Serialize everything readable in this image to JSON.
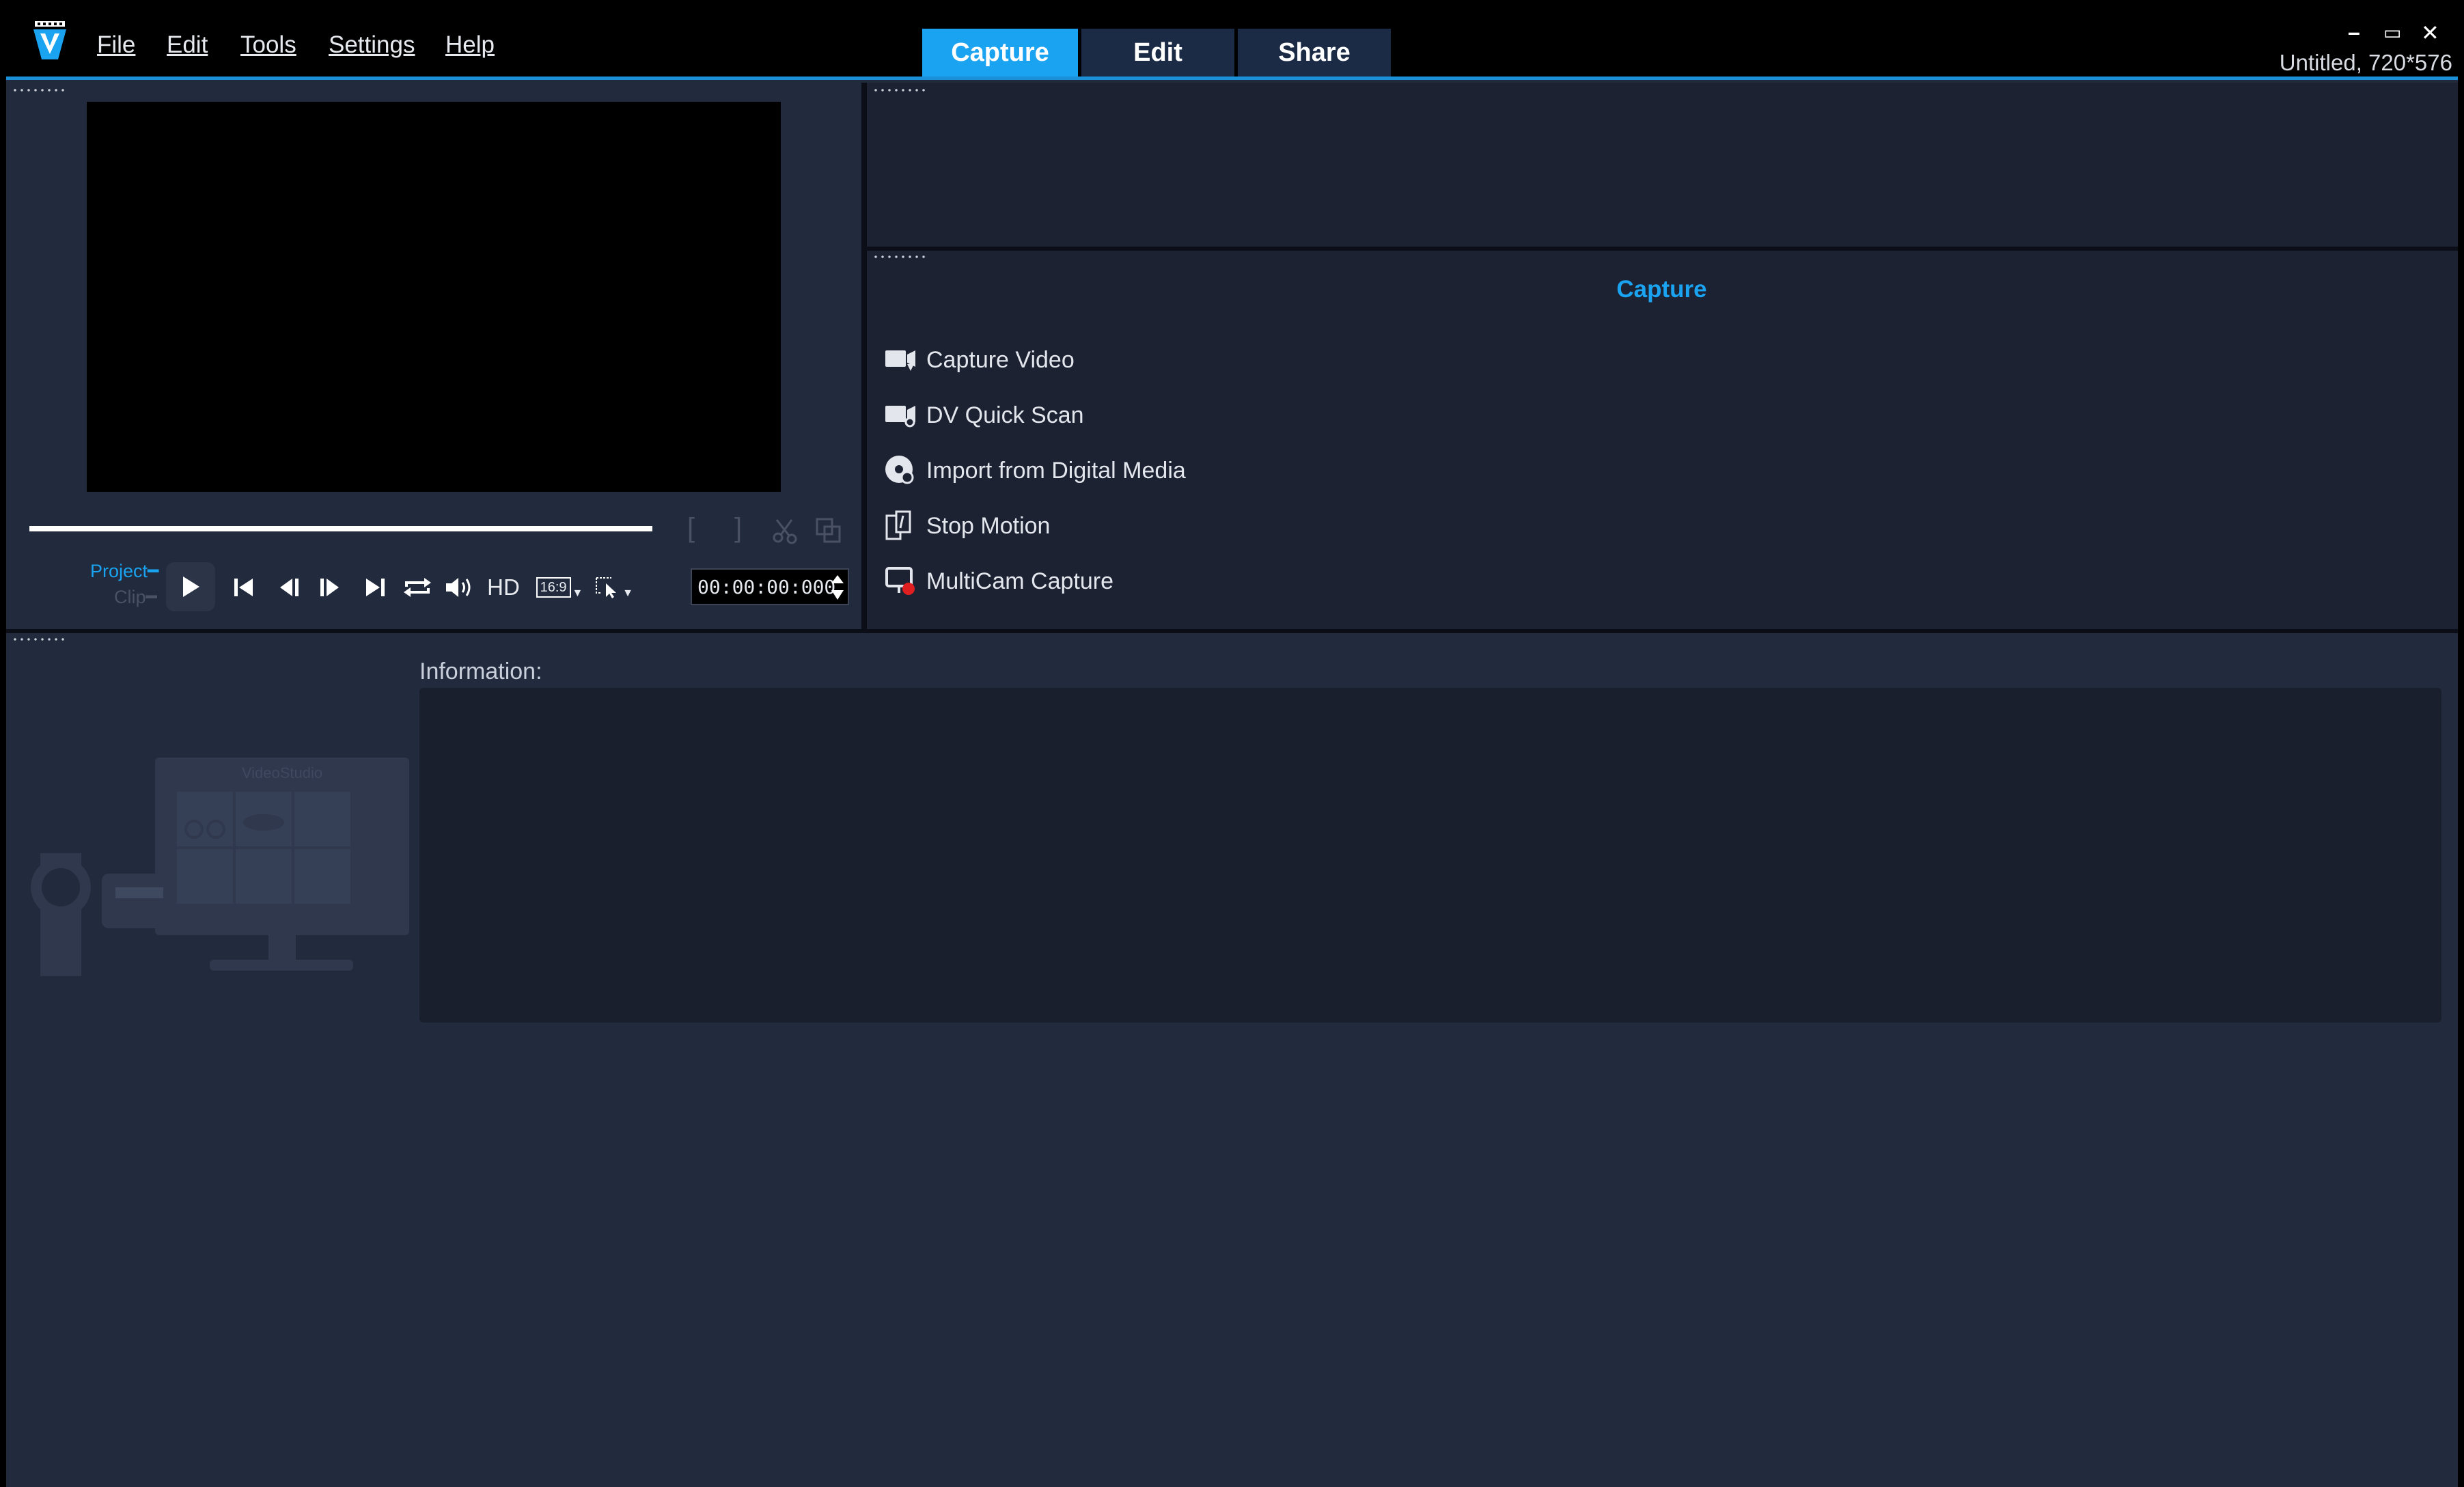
{
  "menu": {
    "file": "File",
    "edit": "Edit",
    "tools": "Tools",
    "settings": "Settings",
    "help": "Help"
  },
  "tabs": {
    "capture": "Capture",
    "edit": "Edit",
    "share": "Share"
  },
  "window": {
    "project_info": "Untitled, 720*576",
    "minimize": "–",
    "restore": "▭",
    "close": "✕"
  },
  "player": {
    "mark_in": "[",
    "mark_out": "]",
    "mode_project": "Project",
    "mode_clip": "Clip",
    "hd": "HD",
    "aspect": "16:9",
    "timecode": "00:00:00:000"
  },
  "capture_panel": {
    "title": "Capture",
    "items": [
      {
        "label": "Capture Video",
        "icon": "capture-video-icon"
      },
      {
        "label": "DV Quick Scan",
        "icon": "dv-quick-scan-icon"
      },
      {
        "label": "Import from Digital Media",
        "icon": "import-digital-media-icon"
      },
      {
        "label": "Stop Motion",
        "icon": "stop-motion-icon"
      },
      {
        "label": "MultiCam Capture",
        "icon": "multicam-capture-icon"
      }
    ]
  },
  "info": {
    "label": "Information:"
  },
  "illustration": {
    "brand": "VideoStudio"
  },
  "colors": {
    "accent": "#1aa3f0",
    "background": "#222a3d",
    "panel": "#1c2232",
    "record": "#e02020"
  }
}
